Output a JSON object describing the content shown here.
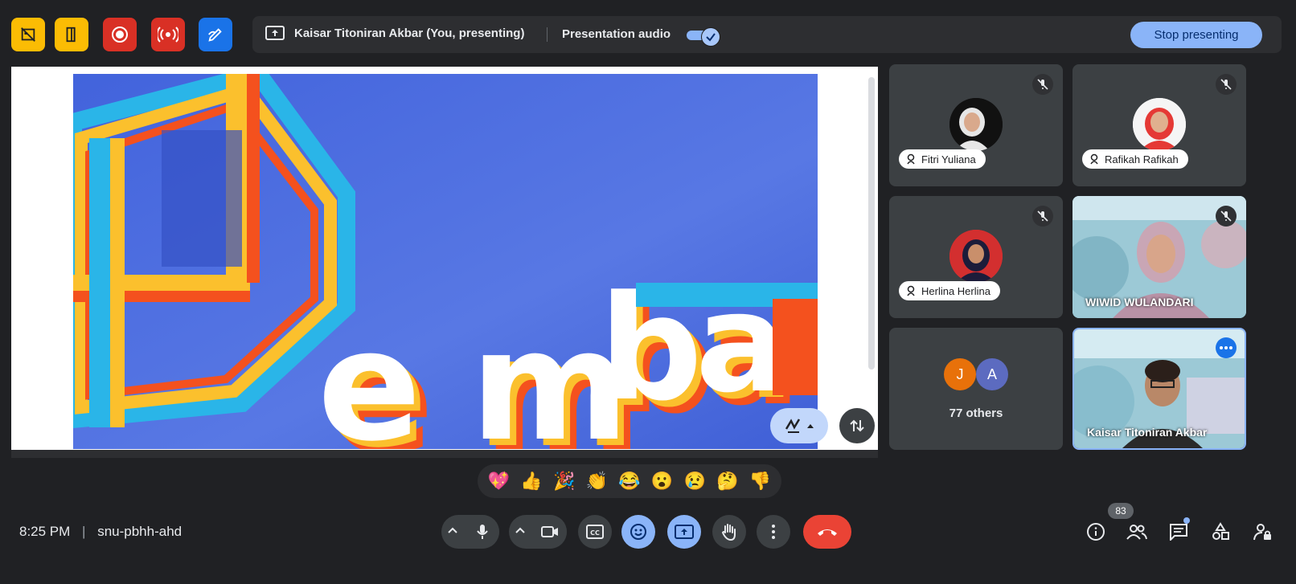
{
  "top": {
    "presenter_text": "Kaisar Titoniran Akbar (You, presenting)",
    "audio_label": "Presentation audio",
    "audio_on": true,
    "stop_label": "Stop presenting",
    "left_buttons": [
      {
        "icon": "no-video-icon",
        "color": "#fbbc04"
      },
      {
        "icon": "door-exit-icon",
        "color": "#fbbc04"
      },
      {
        "icon": "record-icon",
        "color": "#d93025"
      },
      {
        "icon": "live-stream-icon",
        "color": "#d93025"
      },
      {
        "icon": "whiteboard-pen-icon",
        "color": "#1a73e8"
      }
    ]
  },
  "participants": [
    {
      "name": "Fitri Yuliana",
      "muted": true,
      "type": "avatar"
    },
    {
      "name": "Rafikah Rafikah",
      "muted": true,
      "type": "avatar"
    },
    {
      "name": "Herlina Herlina",
      "muted": true,
      "type": "avatar"
    },
    {
      "name": "WIWID WULANDARI",
      "muted": true,
      "type": "video"
    },
    {
      "others_label": "77 others",
      "initials": [
        "J",
        "A"
      ],
      "type": "others"
    },
    {
      "name": "Kaisar Titoniran Akbar",
      "type": "video-self"
    }
  ],
  "reactions": [
    "💖",
    "👍",
    "🎉",
    "👏",
    "😂",
    "😮",
    "😢",
    "🤔",
    "👎"
  ],
  "bottom": {
    "time": "8:25 PM",
    "meeting_code": "snu-pbhh-ahd",
    "people_count": "83"
  },
  "colors": {
    "background": "#202124",
    "tile": "#3c4043",
    "accent": "#8ab4f8",
    "end_call": "#ea4335"
  }
}
